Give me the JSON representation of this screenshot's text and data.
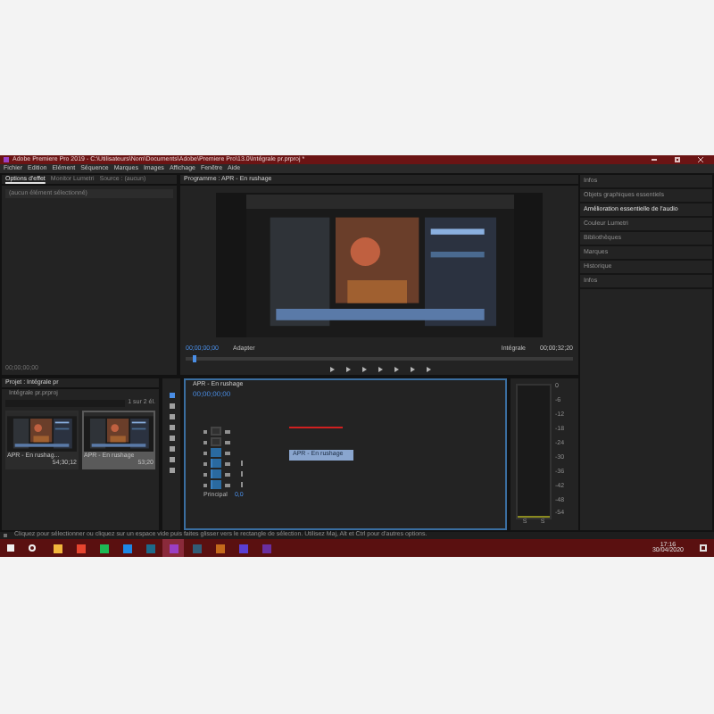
{
  "window": {
    "title": "Adobe Premiere Pro 2019 - C:\\Utilisateurs\\Nom\\Documents\\Adobe\\Premiere Pro\\13.0\\Intégrale pr.prproj *"
  },
  "menu": [
    "Fichier",
    "Edition",
    "Elément",
    "Séquence",
    "Marques",
    "Images",
    "Affichage",
    "Fenêtre",
    "Aide"
  ],
  "source_panel": {
    "tabs": [
      {
        "label": "Options d'effet",
        "selected": true
      },
      {
        "label": "Monitor Lumetri",
        "selected": false
      },
      {
        "label": "Source : (aucun)",
        "selected": false
      }
    ],
    "message": "(aucun élément sélectionné)",
    "timecode": "00;00;00;00"
  },
  "program": {
    "title": "Programme : APR - En rushage",
    "timecode": "00;00;00;00",
    "fit": "Adapter",
    "quality": "Intégrale",
    "duration": "00;00;32;20"
  },
  "right_panel": {
    "items": [
      {
        "label": "Infos",
        "selected": false
      },
      {
        "label": "Objets graphiques essentiels",
        "selected": false
      },
      {
        "label": "Amélioration essentielle de l'audio",
        "selected": true
      },
      {
        "label": "Couleur Lumetri",
        "selected": false
      },
      {
        "label": "Bibliothèques",
        "selected": false
      },
      {
        "label": "Marques",
        "selected": false
      },
      {
        "label": "Historique",
        "selected": false
      },
      {
        "label": "Infos",
        "selected": false
      }
    ]
  },
  "project": {
    "title": "Projet : Intégrale pr",
    "file": "Intégrale pr.prproj",
    "count": "1 sur 2 él.",
    "items": [
      {
        "name": "APR - En rushag...",
        "duration": "54;30;12",
        "selected": false
      },
      {
        "name": "APR - En rushage",
        "duration": "53;20",
        "selected": true
      }
    ]
  },
  "timeline": {
    "title": "APR - En rushage",
    "timecode": "00;00;00;00",
    "tracks": [
      {
        "kind": "video",
        "patched": false
      },
      {
        "kind": "video",
        "patched": false
      },
      {
        "kind": "video",
        "patched": true
      },
      {
        "kind": "audio",
        "patched": true
      },
      {
        "kind": "audio",
        "patched": true
      },
      {
        "kind": "audio",
        "patched": true
      }
    ],
    "master": "Principal",
    "master_value": "0,0",
    "clip": "APR - En rushage"
  },
  "meter": {
    "scale": [
      "0",
      "-6",
      "-12",
      "-18",
      "-24",
      "-30",
      "-36",
      "-42",
      "-48",
      "-54"
    ],
    "channels": [
      "S",
      "S"
    ]
  },
  "status": "Cliquez pour sélectionner ou cliquez sur un espace vide puis faites glisser vers le rectangle de sélection. Utilisez Maj, Alt et Ctrl pour d'autres options.",
  "taskbar": {
    "apps": [
      {
        "color": "#f2b73c",
        "active": false
      },
      {
        "color": "#e6452f",
        "active": false
      },
      {
        "color": "#1db954",
        "active": false
      },
      {
        "color": "#1e88e5",
        "active": false
      },
      {
        "color": "#1d6a8a",
        "active": false
      },
      {
        "color": "#9a3fc4",
        "active": true
      },
      {
        "color": "#315c76",
        "active": false
      },
      {
        "color": "#c46a1b",
        "active": false
      },
      {
        "color": "#5a3fd4",
        "active": false
      },
      {
        "color": "#6a2fa0",
        "active": false
      }
    ],
    "time": "17:16",
    "date": "30/04/2020"
  }
}
